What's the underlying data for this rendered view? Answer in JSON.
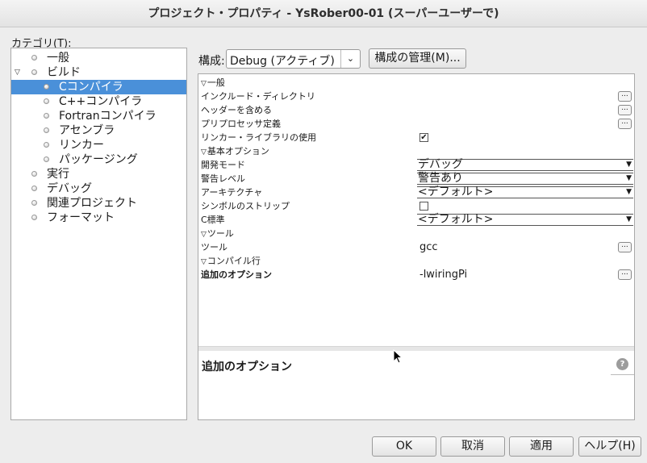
{
  "window": {
    "title": "プロジェクト・プロパティ - YsRober00-01 (スーパーユーザーで)"
  },
  "categories": {
    "label": "カテゴリ(T):",
    "items": [
      {
        "label": "一般",
        "level": 0
      },
      {
        "label": "ビルド",
        "level": 0,
        "expanded": true
      },
      {
        "label": "Cコンパイラ",
        "level": 1,
        "selected": true
      },
      {
        "label": "C++コンパイラ",
        "level": 1
      },
      {
        "label": "Fortranコンパイラ",
        "level": 1
      },
      {
        "label": "アセンブラ",
        "level": 1
      },
      {
        "label": "リンカー",
        "level": 1
      },
      {
        "label": "パッケージング",
        "level": 1
      },
      {
        "label": "実行",
        "level": 0
      },
      {
        "label": "デバッグ",
        "level": 0
      },
      {
        "label": "関連プロジェクト",
        "level": 0
      },
      {
        "label": "フォーマット",
        "level": 0
      }
    ]
  },
  "config": {
    "label": "構成:",
    "selected": "Debug (アクティブ)",
    "manage_button": "構成の管理(M)..."
  },
  "properties": {
    "rows": [
      {
        "type": "section",
        "label": "一般"
      },
      {
        "type": "button",
        "label": "インクルード・ディレクトリ",
        "value": ""
      },
      {
        "type": "button",
        "label": "ヘッダーを含める",
        "value": ""
      },
      {
        "type": "button",
        "label": "プリプロセッサ定義",
        "value": ""
      },
      {
        "type": "check",
        "label": "リンカー・ライブラリの使用",
        "checked": true
      },
      {
        "type": "section",
        "label": "基本オプション"
      },
      {
        "type": "combo",
        "label": "開発モード",
        "value": "デバッグ"
      },
      {
        "type": "combo",
        "label": "警告レベル",
        "value": "警告あり"
      },
      {
        "type": "combo",
        "label": "アーキテクチャ",
        "value": "<デフォルト>"
      },
      {
        "type": "check",
        "label": "シンボルのストリップ",
        "checked": false
      },
      {
        "type": "combo",
        "label": "C標準",
        "value": "<デフォルト>"
      },
      {
        "type": "section",
        "label": "ツール"
      },
      {
        "type": "button",
        "label": "ツール",
        "value": "gcc"
      },
      {
        "type": "section",
        "label": "コンパイル行"
      },
      {
        "type": "button",
        "label": "追加のオプション",
        "value": "-lwiringPi",
        "bold": true
      }
    ]
  },
  "description": {
    "title": "追加のオプション"
  },
  "buttons": {
    "ok": "OK",
    "cancel": "取消",
    "apply": "適用",
    "help": "ヘルプ(H)"
  },
  "icons": {
    "expanded": "▽",
    "dropdown": "⌄",
    "combo_arrow": "▼",
    "ellipsis": "...",
    "check": "✔",
    "help": "?"
  },
  "colors": {
    "selection": "#4a90d9",
    "background": "#ededed"
  }
}
